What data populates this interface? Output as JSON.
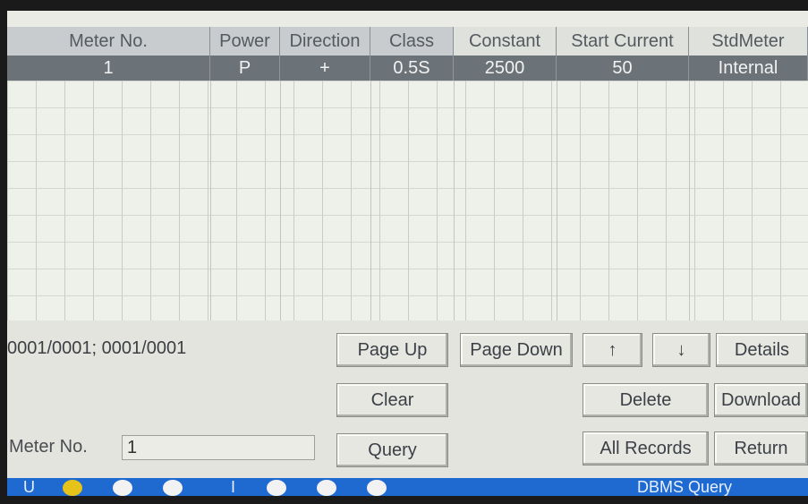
{
  "table": {
    "headers": [
      "Meter No.",
      "Power",
      "Direction",
      "Class",
      "Constant",
      "Start Current",
      "StdMeter"
    ],
    "rows": [
      [
        "1",
        "P",
        "+",
        "0.5S",
        "2500",
        "50",
        "Internal"
      ]
    ]
  },
  "panel": {
    "page_info": "0001/0001; 0001/0001",
    "buttons": {
      "page_up": "Page Up",
      "page_down": "Page Down",
      "up": "↑",
      "down": "↓",
      "details": "Details",
      "clear": "Clear",
      "delete": "Delete",
      "download": "Download",
      "query": "Query",
      "all_records": "All Records",
      "return": "Return"
    },
    "meter_no_label": "Meter No.",
    "meter_no_value": "1"
  },
  "status_bar": {
    "left_label": "U",
    "mid_label": "I",
    "title": "DBMS Query",
    "indicator_colors": {
      "active": "#e7c21a",
      "idle": "#f2f2f2",
      "bar": "#1f6ad0"
    }
  }
}
